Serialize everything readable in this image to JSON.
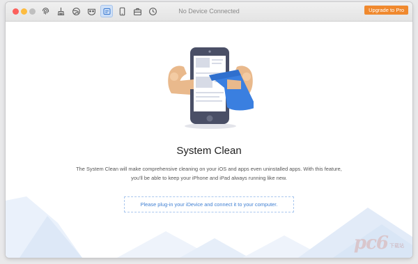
{
  "window": {
    "title": "No Device Connected",
    "upgrade_label": "Upgrade to Pro"
  },
  "toolbar": {
    "items": [
      {
        "icon": "fingerprint-icon",
        "active": false
      },
      {
        "icon": "broom-icon",
        "active": false
      },
      {
        "icon": "globe-icon",
        "active": false
      },
      {
        "icon": "mask-icon",
        "active": false
      },
      {
        "icon": "system-clean-icon",
        "active": true
      },
      {
        "icon": "phone-icon",
        "active": false
      },
      {
        "icon": "toolbox-icon",
        "active": false
      },
      {
        "icon": "history-icon",
        "active": false
      }
    ]
  },
  "main": {
    "heading": "System Clean",
    "description": "The System Clean will make comprehensive cleaning on your iOS and apps even uninstalled apps. With this feature, you'll be able to keep your iPhone and iPad always running like new.",
    "notice": "Please plug-in your iDevice and connect it to your computer."
  },
  "watermark": {
    "logo": "pc6",
    "sub": "下载站"
  },
  "colors": {
    "accent": "#f0892e",
    "link": "#3f7fd2",
    "phone": "#4a4f66",
    "cape": "#3a7fe0",
    "skin": "#e9b98c"
  }
}
